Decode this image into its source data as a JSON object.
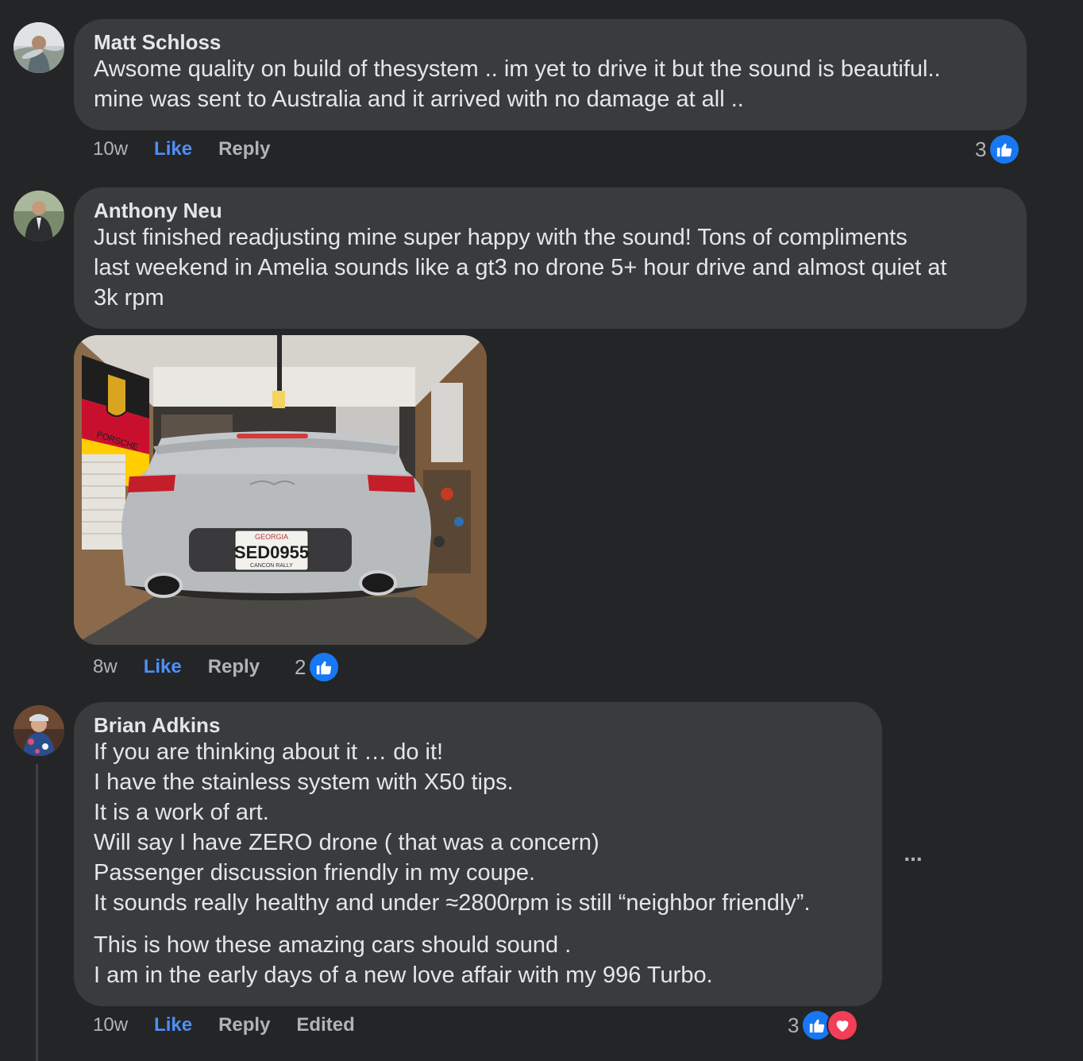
{
  "comments": [
    {
      "author": "Matt Schloss",
      "lines": [
        "Awsome quality on build of thesystem .. im yet to drive it but the sound is beautiful..",
        "mine was sent to Australia and it arrived with no damage at all .."
      ],
      "time": "10w",
      "like_label": "Like",
      "reply_label": "Reply",
      "reaction_count": "3",
      "reactions": [
        "like-icon"
      ]
    },
    {
      "author": "Anthony Neu",
      "lines": [
        "Just finished readjusting mine super happy with the sound! Tons of compliments",
        "last weekend in Amelia sounds like a gt3 no drone 5+ hour drive and almost quiet at",
        "3k rpm"
      ],
      "photo": {
        "plate_state": "GEORGIA",
        "plate_number": "SED0955",
        "plate_frame": "CANCON RALLY",
        "banner": "PORSCHE"
      },
      "time": "8w",
      "like_label": "Like",
      "reply_label": "Reply",
      "reaction_count": "2",
      "reactions": [
        "like-icon"
      ]
    },
    {
      "author": "Brian Adkins",
      "lines": [
        "If you are thinking about it … do it!",
        "I have the stainless system with X50 tips.",
        "It is a work of art.",
        "Will say I have ZERO drone ( that was a concern)",
        "Passenger discussion friendly in my coupe.",
        "It sounds really healthy and under ≈2800rpm is still “neighbor friendly”."
      ],
      "lines2": [
        "This is how these amazing cars should sound .",
        "I am in the early days of a new love affair with my 996 Turbo."
      ],
      "time": "10w",
      "like_label": "Like",
      "reply_label": "Reply",
      "edited_label": "Edited",
      "reaction_count": "3",
      "reactions": [
        "like-icon",
        "heart-icon"
      ],
      "more_label": "..."
    }
  ],
  "colors": {
    "background": "#242526",
    "bubble": "#3a3b3c",
    "like_blue": "#4e8ff8",
    "reaction_like": "#1877f2",
    "reaction_love": "#f33e58"
  }
}
